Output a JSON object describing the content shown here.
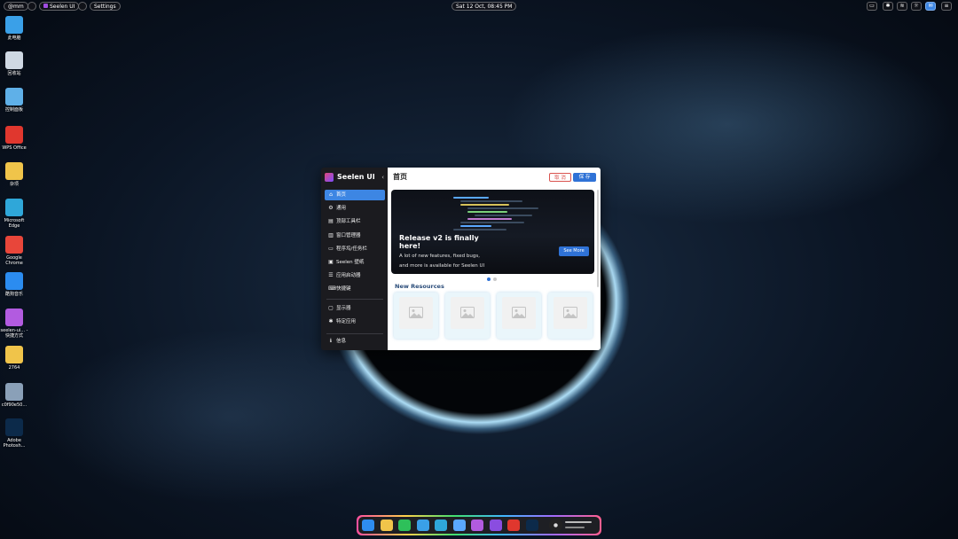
{
  "topbar": {
    "left": [
      "@mm",
      "Seelen UI",
      "Settings"
    ],
    "clock": "Sat 12 Oct, 08:45 PM"
  },
  "desktop_icons": [
    {
      "label": "此电脑",
      "icon": "computer-icon",
      "color": "#3aa0e8"
    },
    {
      "label": "回收站",
      "icon": "recycle-bin-icon",
      "color": "#cfd8e3"
    },
    {
      "label": "控制面板",
      "icon": "control-panel-icon",
      "color": "#5fb0e8"
    },
    {
      "label": "WPS Office",
      "icon": "wps-office-icon",
      "color": "#e0372e"
    },
    {
      "label": "杂项",
      "icon": "folder-icon",
      "color": "#f0c44a"
    },
    {
      "label": "Microsoft Edge",
      "icon": "edge-icon",
      "color": "#2fa7d9"
    },
    {
      "label": "Google Chrome",
      "icon": "chrome-icon",
      "color": "#e8463a"
    },
    {
      "label": "酷狗音乐",
      "icon": "kugou-icon",
      "color": "#2b8cf0"
    },
    {
      "label": "seelen-ui... - 快捷方式",
      "icon": "seelen-ui-shortcut-icon",
      "color": "#b25be0"
    },
    {
      "label": "2764",
      "icon": "folder-icon",
      "color": "#f0c44a"
    },
    {
      "label": "c0f90e50...",
      "icon": "file-icon",
      "color": "#8aa0b8"
    },
    {
      "label": "Adobe Photosh...",
      "icon": "photoshop-icon",
      "color": "#0c2a4a"
    }
  ],
  "sidebar": {
    "title": "Seelen UI",
    "collapse": "‹",
    "items": [
      {
        "label": "首页",
        "icon": "⌂",
        "icon_name": "home-icon",
        "active": true
      },
      {
        "label": "通用",
        "icon": "⚙",
        "icon_name": "gear-icon",
        "active": false
      },
      {
        "label": "顶部工具栏",
        "icon": "▤",
        "icon_name": "toolbar-icon",
        "active": false
      },
      {
        "label": "窗口管理器",
        "icon": "▥",
        "icon_name": "window-manager-icon",
        "active": false
      },
      {
        "label": "程序坞/任务栏",
        "icon": "▭",
        "icon_name": "dock-icon",
        "active": false
      },
      {
        "label": "Seelen 壁纸",
        "icon": "▣",
        "icon_name": "wallpaper-icon",
        "active": false
      },
      {
        "label": "应用启动器",
        "icon": "☰",
        "icon_name": "launcher-icon",
        "active": false
      },
      {
        "label": "快捷键",
        "icon": "⌨",
        "icon_name": "shortcuts-icon",
        "active": false
      }
    ],
    "items_bottom": [
      {
        "label": "显示器",
        "icon": "▢",
        "icon_name": "monitor-icon"
      },
      {
        "label": "特定应用",
        "icon": "✱",
        "icon_name": "specific-apps-icon"
      }
    ],
    "footer": {
      "label": "信息",
      "icon": "ℹ",
      "icon_name": "info-icon"
    }
  },
  "main": {
    "title": "首页",
    "cancel": "取 消",
    "save": "保 存",
    "banner": {
      "title": "Release v2 is finally here!",
      "desc_line1": "A lot of new features, fixed bugs,",
      "desc_line2": "and more is available for Seelen UI",
      "button": "See More"
    },
    "carousel_dots": 2,
    "section_title": "New Resources"
  },
  "dock": {
    "apps": [
      {
        "name": "windows-start-icon",
        "color": "#2e8cf0"
      },
      {
        "name": "file-explorer-icon",
        "color": "#f0c44a"
      },
      {
        "name": "wechat-icon",
        "color": "#2ec05a"
      },
      {
        "name": "photos-icon",
        "color": "#3aa0e8"
      },
      {
        "name": "edge-icon",
        "color": "#2fa7d9"
      },
      {
        "name": "onedrive-icon",
        "color": "#5aa8ff"
      },
      {
        "name": "affinity-icon",
        "color": "#b25be0"
      },
      {
        "name": "seelen-ui-icon",
        "color": "#8a4de0"
      },
      {
        "name": "wps-office-icon",
        "color": "#e0372e"
      },
      {
        "name": "photoshop-icon",
        "color": "#0c2a4a"
      }
    ]
  },
  "colors": {
    "accent": "#3d86e3",
    "sidebar_bg": "#1b1b1f",
    "cancel": "#d9534f"
  }
}
